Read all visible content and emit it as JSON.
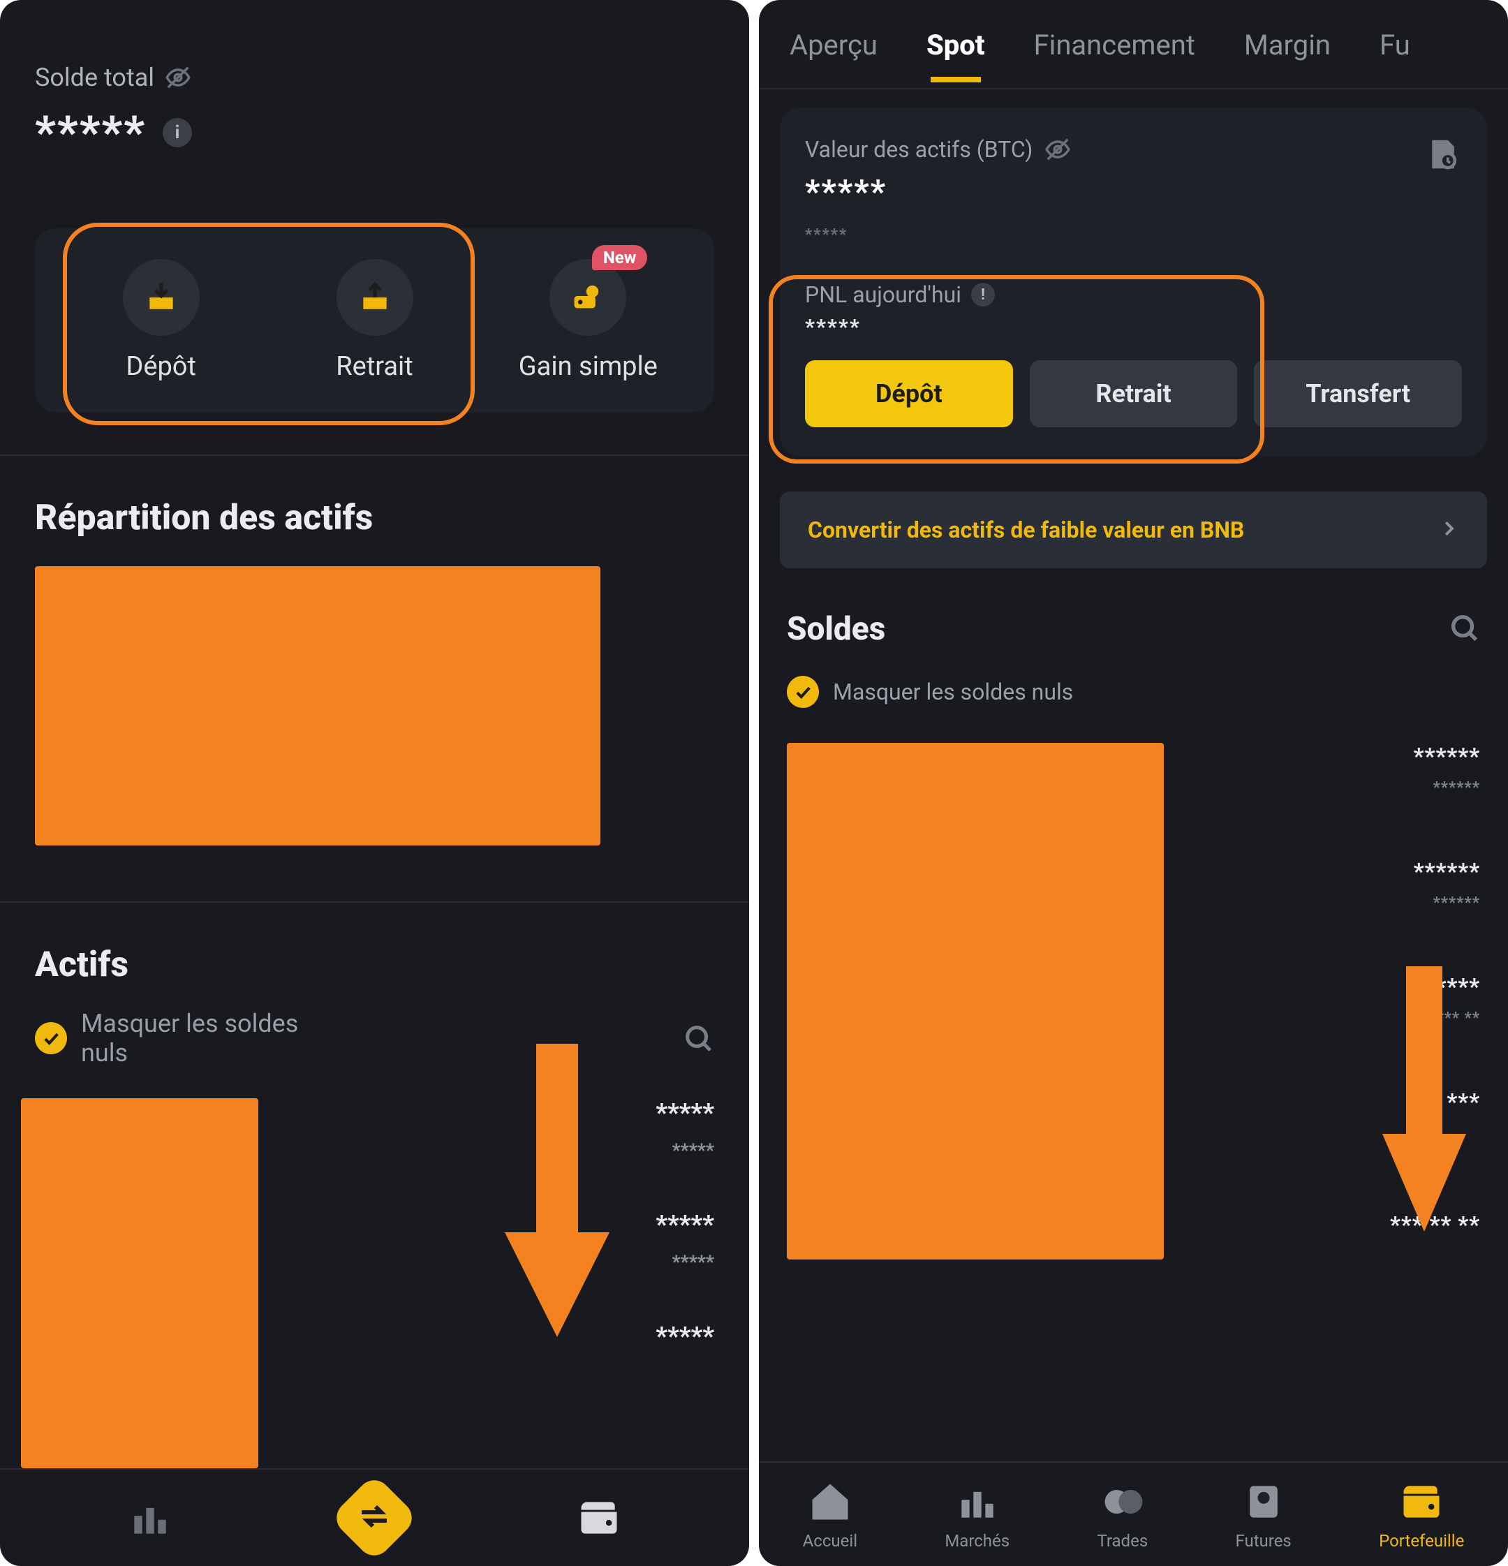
{
  "left": {
    "balance_label": "Solde total",
    "balance_value": "*****",
    "actions": {
      "deposit": "Dépôt",
      "withdraw": "Retrait",
      "earn": "Gain simple",
      "new_badge": "New"
    },
    "repartition_title": "Répartition des actifs",
    "actifs_title": "Actifs",
    "mask_label": "Masquer les soldes nuls",
    "list_stars": {
      "a_big": "*****",
      "a_small": "*****",
      "b_big": "*****",
      "b_small": "*****",
      "c_big": "*****"
    }
  },
  "right": {
    "tabs": {
      "overview": "Aperçu",
      "spot": "Spot",
      "funding": "Financement",
      "margin": "Margin",
      "futures": "Fu"
    },
    "asset_label": "Valeur des actifs (BTC)",
    "asset_value": "*****",
    "asset_sub": "*****",
    "pnl_label": "PNL aujourd'hui",
    "pnl_value": "*****",
    "buttons": {
      "deposit": "Dépôt",
      "withdraw": "Retrait",
      "transfer": "Transfert"
    },
    "convert_label": "Convertir des actifs de faible valeur en BNB",
    "soldes_title": "Soldes",
    "mask_label": "Masquer les soldes nuls",
    "balances": {
      "a_big": "******",
      "a_small": "******",
      "b_big": "******",
      "b_small": "******",
      "c_big": "******",
      "c_small": "***   **",
      "d_big": "*** ***",
      "e_big": "*** ** **"
    },
    "nav": {
      "home": "Accueil",
      "markets": "Marchés",
      "trades": "Trades",
      "futures": "Futures",
      "wallet": "Portefeuille"
    }
  },
  "colors": {
    "highlight": "#f58220",
    "accent": "#f0b90b"
  }
}
